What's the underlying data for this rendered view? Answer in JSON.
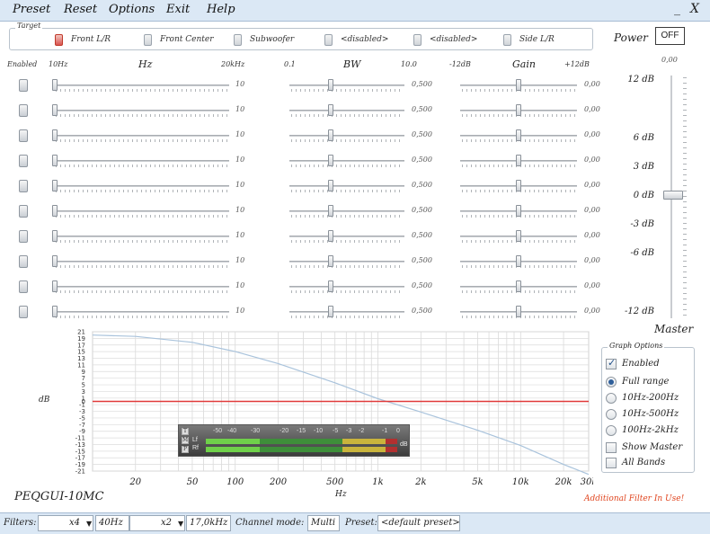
{
  "menu": {
    "items": [
      "Preset",
      "Reset",
      "Options",
      "Exit",
      "Help"
    ]
  },
  "window": {
    "minimize": "_",
    "close": "X"
  },
  "target": {
    "legend": "Target",
    "items": [
      {
        "label": "Front L/R",
        "checked": true
      },
      {
        "label": "Front Center",
        "checked": false
      },
      {
        "label": "Subwoofer",
        "checked": false
      },
      {
        "label": "<disabled>",
        "checked": false
      },
      {
        "label": "<disabled>",
        "checked": false
      },
      {
        "label": "Side L/R",
        "checked": false
      }
    ]
  },
  "power": {
    "label": "Power",
    "button": "OFF"
  },
  "headers": {
    "enabled": "Enabled",
    "hz_min": "10Hz",
    "hz": "Hz",
    "hz_max": "20kHz",
    "bw_min": "0.1",
    "bw": "BW",
    "bw_max": "10.0",
    "gain_min": "-12dB",
    "gain": "Gain",
    "gain_max": "+12dB"
  },
  "bands": [
    {
      "enabled": false,
      "hz": "10",
      "bw": "0,500",
      "gain": "0,00"
    },
    {
      "enabled": false,
      "hz": "10",
      "bw": "0,500",
      "gain": "0,00"
    },
    {
      "enabled": false,
      "hz": "10",
      "bw": "0,500",
      "gain": "0,00"
    },
    {
      "enabled": false,
      "hz": "10",
      "bw": "0,500",
      "gain": "0,00"
    },
    {
      "enabled": false,
      "hz": "10",
      "bw": "0,500",
      "gain": "0,00"
    },
    {
      "enabled": false,
      "hz": "10",
      "bw": "0,500",
      "gain": "0,00"
    },
    {
      "enabled": false,
      "hz": "10",
      "bw": "0,500",
      "gain": "0,00"
    },
    {
      "enabled": false,
      "hz": "10",
      "bw": "0,500",
      "gain": "0,00"
    },
    {
      "enabled": false,
      "hz": "10",
      "bw": "0,500",
      "gain": "0,00"
    },
    {
      "enabled": false,
      "hz": "10",
      "bw": "0,500",
      "gain": "0,00"
    }
  ],
  "master": {
    "value": "0,00",
    "ticks": [
      "12 dB",
      "6 dB",
      "3 dB",
      "0 dB",
      "-3 dB",
      "-6 dB",
      "-12 dB"
    ],
    "label": "Master"
  },
  "chart_data": {
    "type": "line",
    "xlabel": "Hz",
    "ylabel": "dB",
    "x_scale": "log",
    "xlim": [
      10,
      30000
    ],
    "ylim": [
      -21,
      21
    ],
    "x_tick_labels": [
      "20",
      "50",
      "100",
      "200",
      "500",
      "1k",
      "2k",
      "5k",
      "10k",
      "20k",
      "30k"
    ],
    "y_tick_labels": [
      "21",
      "19",
      "17",
      "15",
      "13",
      "11",
      "9",
      "7",
      "5",
      "3",
      "1",
      "0",
      "-1",
      "-3",
      "-5",
      "-7",
      "-9",
      "-11",
      "-13",
      "-15",
      "-17",
      "-19",
      "-21"
    ],
    "grid": true,
    "series": [
      {
        "color": "#a9c3dc",
        "x": [
          10,
          20,
          50,
          100,
          200,
          500,
          1000,
          2000,
          5000,
          10000,
          20000,
          30000
        ],
        "y": [
          20,
          19.6,
          17.8,
          15,
          11.4,
          5.6,
          0.8,
          -3.2,
          -8.7,
          -13.3,
          -19,
          -22
        ]
      },
      {
        "color": "#e03a3a",
        "x": [
          10,
          30000
        ],
        "y": [
          0,
          0
        ]
      }
    ]
  },
  "meter": {
    "scale": [
      "-50",
      "-40",
      "-30",
      "-20",
      "-15",
      "-10",
      "-5",
      "-3",
      "-2",
      "-1",
      "0"
    ],
    "channels": [
      {
        "label": "Lf",
        "level_db": -30
      },
      {
        "label": "Rf",
        "level_db": -30
      }
    ],
    "unit": "dB",
    "buttons": [
      "T",
      "M",
      "P"
    ]
  },
  "graph_options": {
    "legend": "Graph Options",
    "enabled": {
      "label": "Enabled",
      "checked": true
    },
    "ranges": [
      {
        "label": "Full range",
        "selected": true
      },
      {
        "label": "10Hz-200Hz",
        "selected": false
      },
      {
        "label": "10Hz-500Hz",
        "selected": false
      },
      {
        "label": "100Hz-2kHz",
        "selected": false
      }
    ],
    "show_master": {
      "label": "Show Master",
      "checked": false
    },
    "all_bands": {
      "label": "All Bands",
      "checked": false
    }
  },
  "app_name": "PEQGUI-10MC",
  "filter_warning": "Additional Filter In Use!",
  "status": {
    "filters_label": "Filters:",
    "filter1_mult": "x4",
    "filter1_freq": "40Hz",
    "filter2_mult": "x2",
    "filter2_freq": "17,0kHz",
    "channel_mode_label": "Channel mode:",
    "channel_mode": "Multi",
    "preset_label": "Preset:",
    "preset": "<default preset>"
  }
}
